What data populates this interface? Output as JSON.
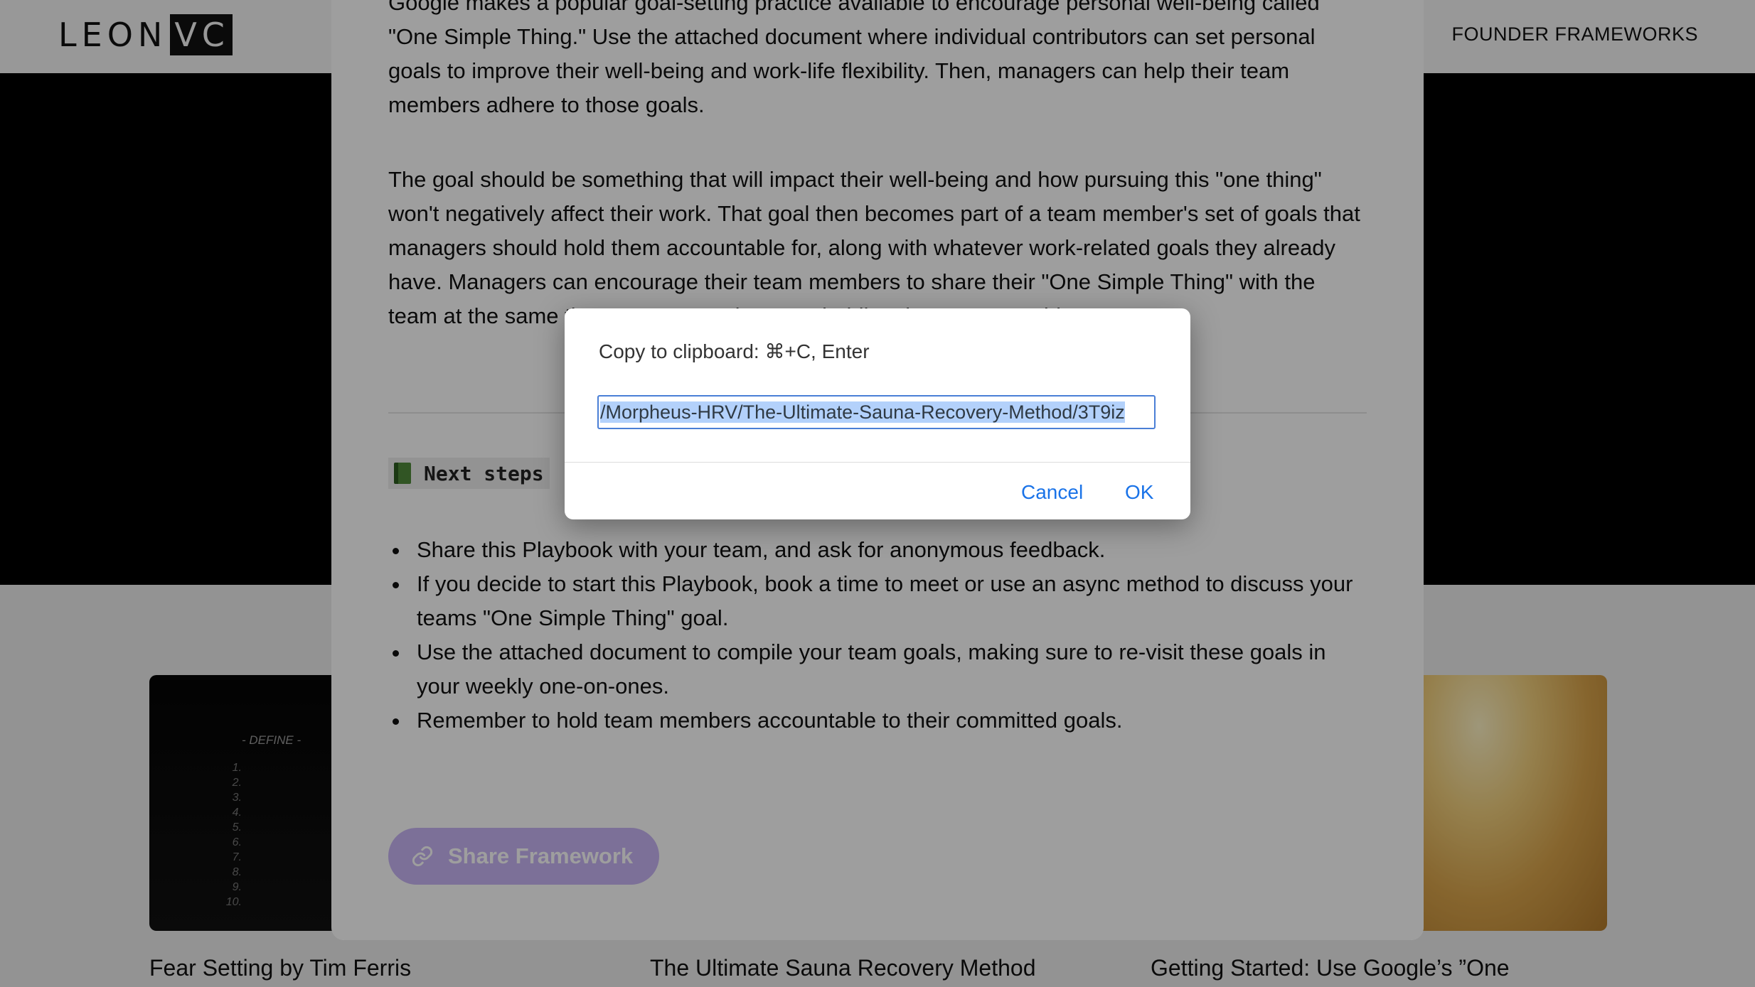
{
  "header": {
    "logo_left": "LEON",
    "logo_right": "VC",
    "nav_link": "FOUNDER FRAMEWORKS"
  },
  "cards": [
    {
      "title": "Fear Setting by Tim Ferris",
      "define_title": "- DEFINE -",
      "define_list": [
        "1.",
        "2.",
        "3.",
        "4.",
        "5.",
        "6.",
        "7.",
        "8.",
        "9.",
        "10."
      ]
    },
    {
      "title": "The Ultimate Sauna Recovery Method"
    },
    {
      "title": "Getting Started: Use Google’s ”One"
    }
  ],
  "article": {
    "paragraph1": "Google makes a popular goal-setting practice available to encourage personal well-being called \"One Simple Thing.\" Use the attached document where individual contributors can set personal goals to improve their well-being and work-life flexibility. Then, managers can help their team members adhere to those goals.",
    "paragraph2": "The goal should be something that will impact their well-being and how pursuing this \"one thing\" won't negatively affect their work. That goal then becomes part of a team member's set of goals that managers should hold them accountable for, along with whatever work-related goals they already have. Managers can encourage their team members to share their \"One Simple Thing\" with the team at the same time, to ensure others are holding them accountable.",
    "next_steps_heading": "Next steps",
    "steps": [
      "Share this Playbook with your team, and ask for anonymous feedback.",
      "If you decide to start this Playbook, book a time to meet or use an async method to discuss your teams \"One Simple Thing\" goal.",
      "Use the attached document to compile your team goals, making sure to re-visit these goals in your weekly one-on-ones.",
      "Remember to hold team members accountable to their committed goals."
    ],
    "share_button": "Share Framework"
  },
  "dialog": {
    "message": "Copy to clipboard: ⌘+C, Enter",
    "input_value": "/Morpheus-HRV/The-Ultimate-Sauna-Recovery-Method/3T9iz",
    "cancel_label": "Cancel",
    "ok_label": "OK"
  },
  "icons": {
    "next_steps": "green-book-icon",
    "share": "link-icon"
  }
}
